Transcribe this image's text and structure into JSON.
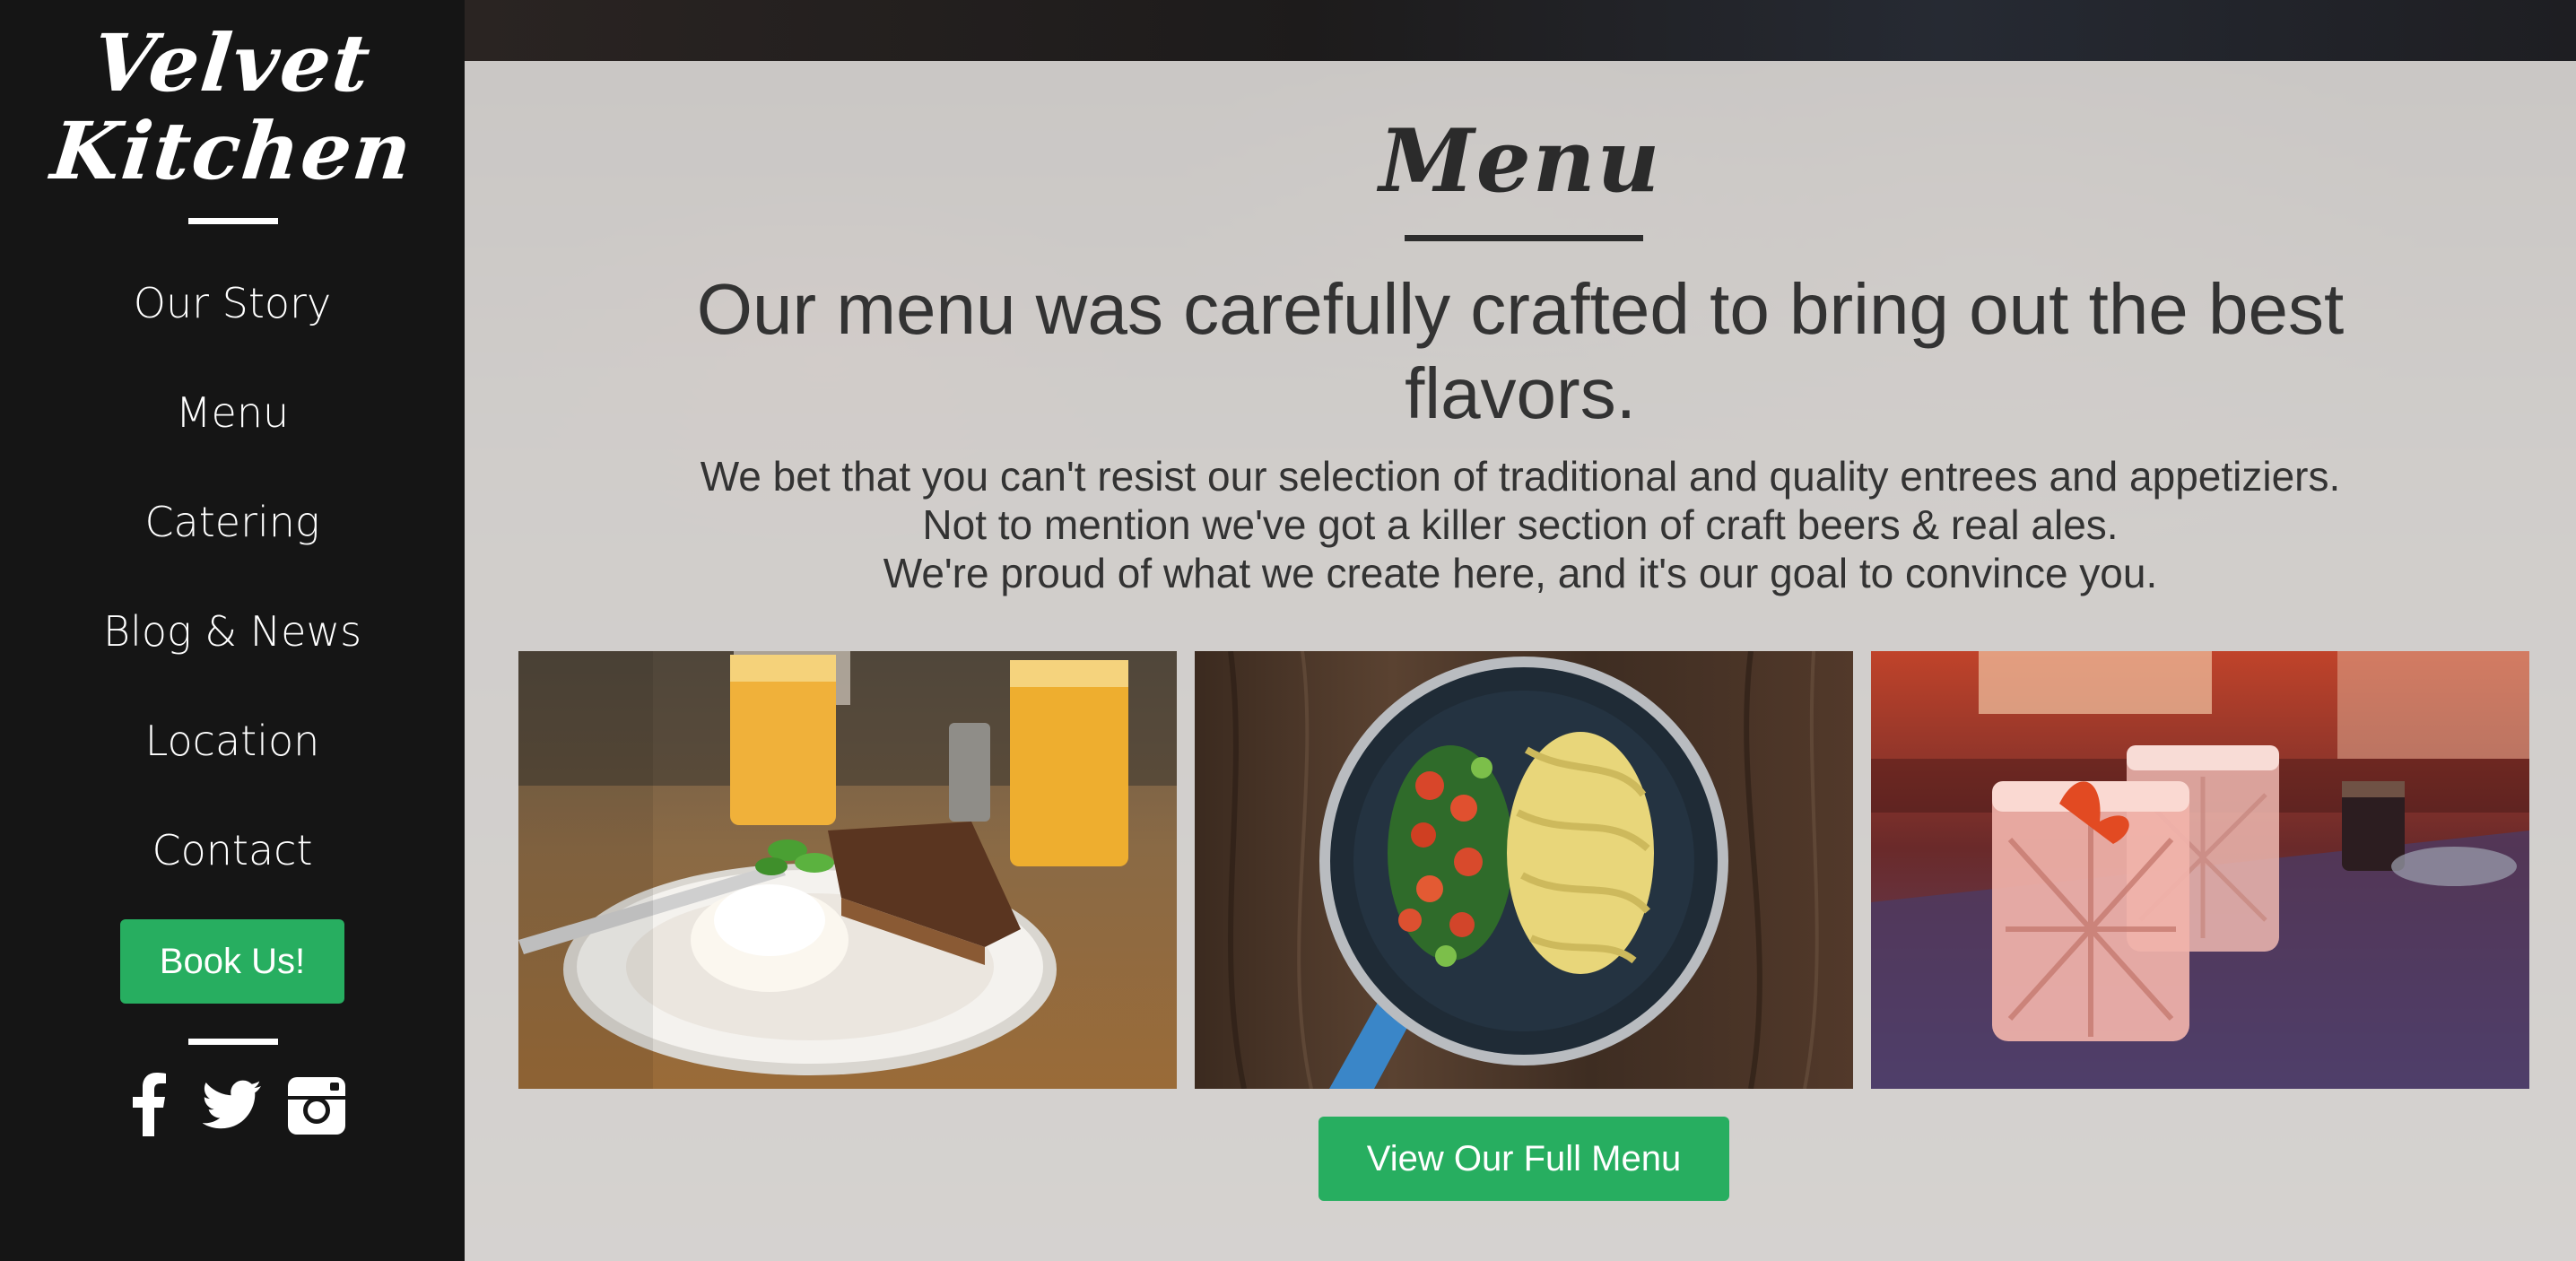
{
  "sidebar": {
    "brand_line1": "Velvet",
    "brand_line2": "Kitchen",
    "nav": [
      {
        "label": "Our Story"
      },
      {
        "label": "Menu"
      },
      {
        "label": "Catering"
      },
      {
        "label": "Blog & News"
      },
      {
        "label": "Location"
      },
      {
        "label": "Contact"
      }
    ],
    "book_label": "Book Us!",
    "social_icons": [
      "facebook-icon",
      "twitter-icon",
      "instagram-icon"
    ]
  },
  "main": {
    "title": "Menu",
    "headline": "Our menu was carefully crafted to bring out the best flavors.",
    "description": [
      "We bet that you can't resist our selection of traditional and quality entrees and appetiziers.",
      "Not to mention we've got a killer section of craft beers & real ales.",
      "We're proud of what we create here, and it's our goal to convince you."
    ],
    "photos": [
      "dessert-plate-photo",
      "pasta-pan-photo",
      "cocktail-glasses-photo"
    ],
    "full_menu_label": "View Our Full Menu"
  },
  "colors": {
    "sidebar_bg": "#151515",
    "accent_green": "#27ae60",
    "text_dark": "#333333"
  }
}
